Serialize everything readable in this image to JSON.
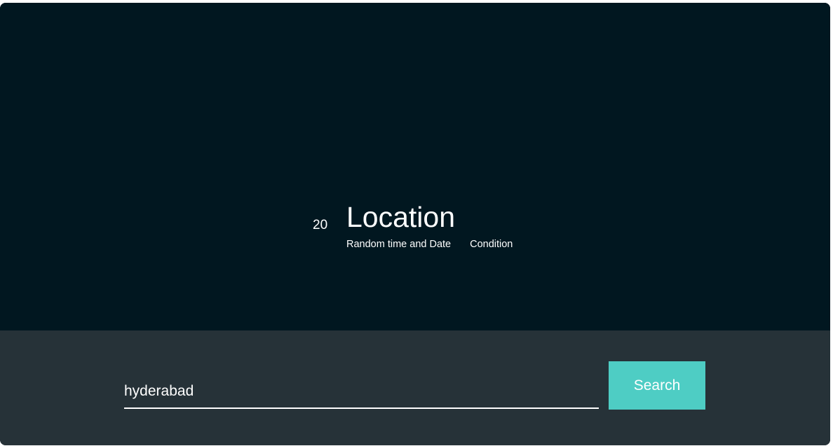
{
  "weather": {
    "temperature": "20",
    "location": "Location",
    "datetime": "Random time and Date",
    "condition": "Condition"
  },
  "search": {
    "value": "hyderabad",
    "placeholder": "",
    "button_label": "Search"
  },
  "colors": {
    "hero_background": "#011720",
    "panel_background": "#263238",
    "accent": "#4ecdc4",
    "text": "#ffffff"
  }
}
